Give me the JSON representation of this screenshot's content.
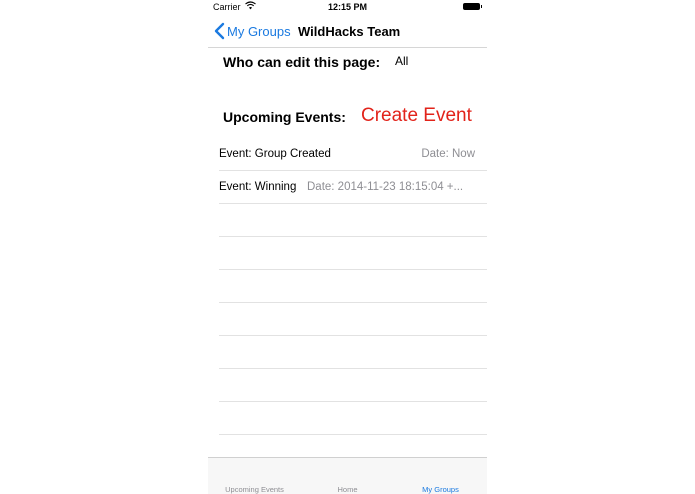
{
  "status_bar": {
    "carrier": "Carrier",
    "time": "12:15 PM"
  },
  "nav": {
    "back_label": "My Groups",
    "title": "WildHacks Team"
  },
  "permissions": {
    "label": "Who can edit this page:",
    "value": "All"
  },
  "events": {
    "header": "Upcoming Events:",
    "create_label": "Create Event",
    "items": [
      {
        "title": "Event: Group Created",
        "date": "Date: Now"
      },
      {
        "title": "Event: Winning",
        "date": "Date: 2014-11-23 18:15:04 +..."
      }
    ]
  },
  "tab_bar": {
    "tabs": [
      {
        "label": "Upcoming Events",
        "active": false
      },
      {
        "label": "Home",
        "active": false
      },
      {
        "label": "My Groups",
        "active": true
      }
    ]
  },
  "colors": {
    "accent": "#1b7ae0",
    "create_event": "#e2231a",
    "secondary_text": "#8e8e93"
  }
}
